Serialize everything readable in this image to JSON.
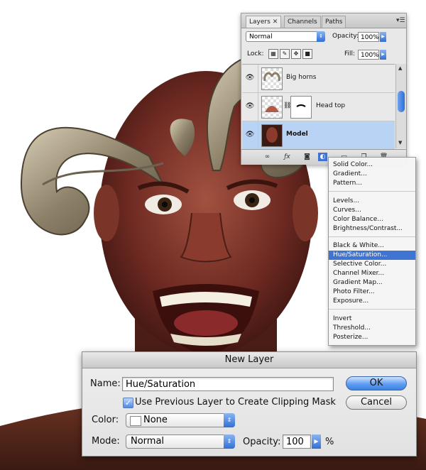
{
  "layers_panel": {
    "tabs": [
      {
        "label": "Layers",
        "close": "✕"
      },
      {
        "label": "Channels"
      },
      {
        "label": "Paths"
      }
    ],
    "blend_mode": "Normal",
    "opacity_label": "Opacity:",
    "opacity_value": "100%",
    "lock_label": "Lock:",
    "fill_label": "Fill:",
    "fill_value": "100%",
    "layers": [
      {
        "name": "Big horns",
        "visible": true,
        "selected": false
      },
      {
        "name": "Head top",
        "visible": true,
        "selected": false
      },
      {
        "name": "Model",
        "visible": true,
        "selected": true
      }
    ]
  },
  "adjustment_menu": {
    "groups": [
      [
        "Solid Color...",
        "Gradient...",
        "Pattern..."
      ],
      [
        "Levels...",
        "Curves...",
        "Color Balance...",
        "Brightness/Contrast..."
      ],
      [
        "Black & White...",
        "Hue/Saturation...",
        "Selective Color...",
        "Channel Mixer...",
        "Gradient Map...",
        "Photo Filter...",
        "Exposure..."
      ],
      [
        "Invert",
        "Threshold...",
        "Posterize..."
      ]
    ],
    "highlighted": "Hue/Saturation..."
  },
  "new_layer_dialog": {
    "title": "New Layer",
    "name_label": "Name:",
    "name_value": "Hue/Saturation",
    "clipping_checkbox_label": "Use Previous Layer to Create Clipping Mask",
    "clipping_checked": true,
    "color_label": "Color:",
    "color_value": "None",
    "mode_label": "Mode:",
    "mode_value": "Normal",
    "opacity_label": "Opacity:",
    "opacity_value": "100",
    "opacity_unit": "%",
    "ok_label": "OK",
    "cancel_label": "Cancel"
  },
  "colors": {
    "arrow": "#d01f1f",
    "highlight": "#3f74d3",
    "selected_layer": "#b8d3f4"
  }
}
